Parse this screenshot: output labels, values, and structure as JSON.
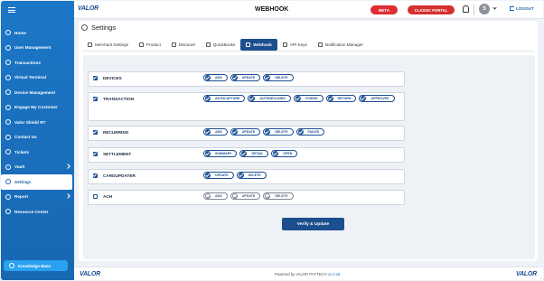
{
  "app": {
    "logo_text": "VALOR",
    "title": "WEBHOOK",
    "beta_label": "BETA",
    "classic_label": "CLASSIC PORTAL",
    "avatar_letter": "S",
    "logout_label": "LOGOUT"
  },
  "sidebar": {
    "items": [
      {
        "label": "Home",
        "icon": "home-icon"
      },
      {
        "label": "User Management",
        "icon": "user-icon"
      },
      {
        "label": "Transactions",
        "icon": "transactions-icon"
      },
      {
        "label": "Virtual Terminal",
        "icon": "terminal-icon"
      },
      {
        "label": "Device Management",
        "icon": "device-icon"
      },
      {
        "label": "Engage My Customer",
        "icon": "engage-icon"
      },
      {
        "label": "Valor Shield RT",
        "icon": "shield-icon"
      },
      {
        "label": "Contact Us",
        "icon": "contact-icon"
      },
      {
        "label": "Tickets",
        "icon": "ticket-icon"
      },
      {
        "label": "Vault",
        "icon": "vault-icon"
      },
      {
        "label": "Settings",
        "icon": "gear-icon"
      },
      {
        "label": "Report",
        "icon": "report-icon"
      },
      {
        "label": "Resource Center",
        "icon": "download-icon"
      }
    ],
    "active_index": 10,
    "knowledge_base_label": "Knowledge Base"
  },
  "settings": {
    "title": "Settings",
    "tabs": [
      {
        "label": "Merchant Settings",
        "icon": "wrench-icon"
      },
      {
        "label": "Product",
        "icon": "box-icon"
      },
      {
        "label": "Discount",
        "icon": "percent-icon"
      },
      {
        "label": "QuickBooks",
        "icon": "quickbooks-icon"
      },
      {
        "label": "Webhook",
        "icon": "webhook-icon"
      },
      {
        "label": "API Keys",
        "icon": "key-icon"
      },
      {
        "label": "Notification Manager",
        "icon": "bell-icon"
      }
    ],
    "active_tab": 4
  },
  "webhook": {
    "rows": [
      {
        "name": "DEVICES",
        "checked": true,
        "events": [
          {
            "label": "ADD",
            "on": true
          },
          {
            "label": "UPDATE",
            "on": true
          },
          {
            "label": "DELETE",
            "on": true
          }
        ]
      },
      {
        "name": "TRANSACTION",
        "checked": true,
        "events": [
          {
            "label": "AUTHCAPTURE",
            "on": true
          },
          {
            "label": "AUTHDECLINED",
            "on": true
          },
          {
            "label": "VOIDED",
            "on": true
          },
          {
            "label": "RETURN",
            "on": true
          },
          {
            "label": "APPROVED",
            "on": true
          }
        ]
      },
      {
        "name": "RECURRING",
        "checked": true,
        "events": [
          {
            "label": "ADD",
            "on": true
          },
          {
            "label": "UPDATE",
            "on": true
          },
          {
            "label": "DELETE",
            "on": true
          },
          {
            "label": "FAILED",
            "on": true
          }
        ]
      },
      {
        "name": "SETTLEMENT",
        "checked": true,
        "events": [
          {
            "label": "SUMMARY",
            "on": true
          },
          {
            "label": "DETAIL",
            "on": true
          },
          {
            "label": "OPEN",
            "on": true
          }
        ]
      },
      {
        "name": "CARDUPDATER",
        "checked": true,
        "events": [
          {
            "label": "UPDATE",
            "on": true
          },
          {
            "label": "DELETE",
            "on": true
          }
        ]
      },
      {
        "name": "ACH",
        "checked": false,
        "events": [
          {
            "label": "ADD",
            "on": false
          },
          {
            "label": "UPDATE",
            "on": false
          },
          {
            "label": "DELETE",
            "on": false
          }
        ]
      }
    ],
    "verify_label": "Verify & Update"
  },
  "footer": {
    "powered_prefix": "Powered by VALOR PAYTECH",
    "version": "v1.0.16",
    "logo_left": "VALOR",
    "logo_right": "VALOR"
  },
  "colors": {
    "sidebar": "#1c77c7",
    "primary": "#1c4f8e",
    "beta": "#e02d33",
    "classic": "#d62f2f"
  }
}
